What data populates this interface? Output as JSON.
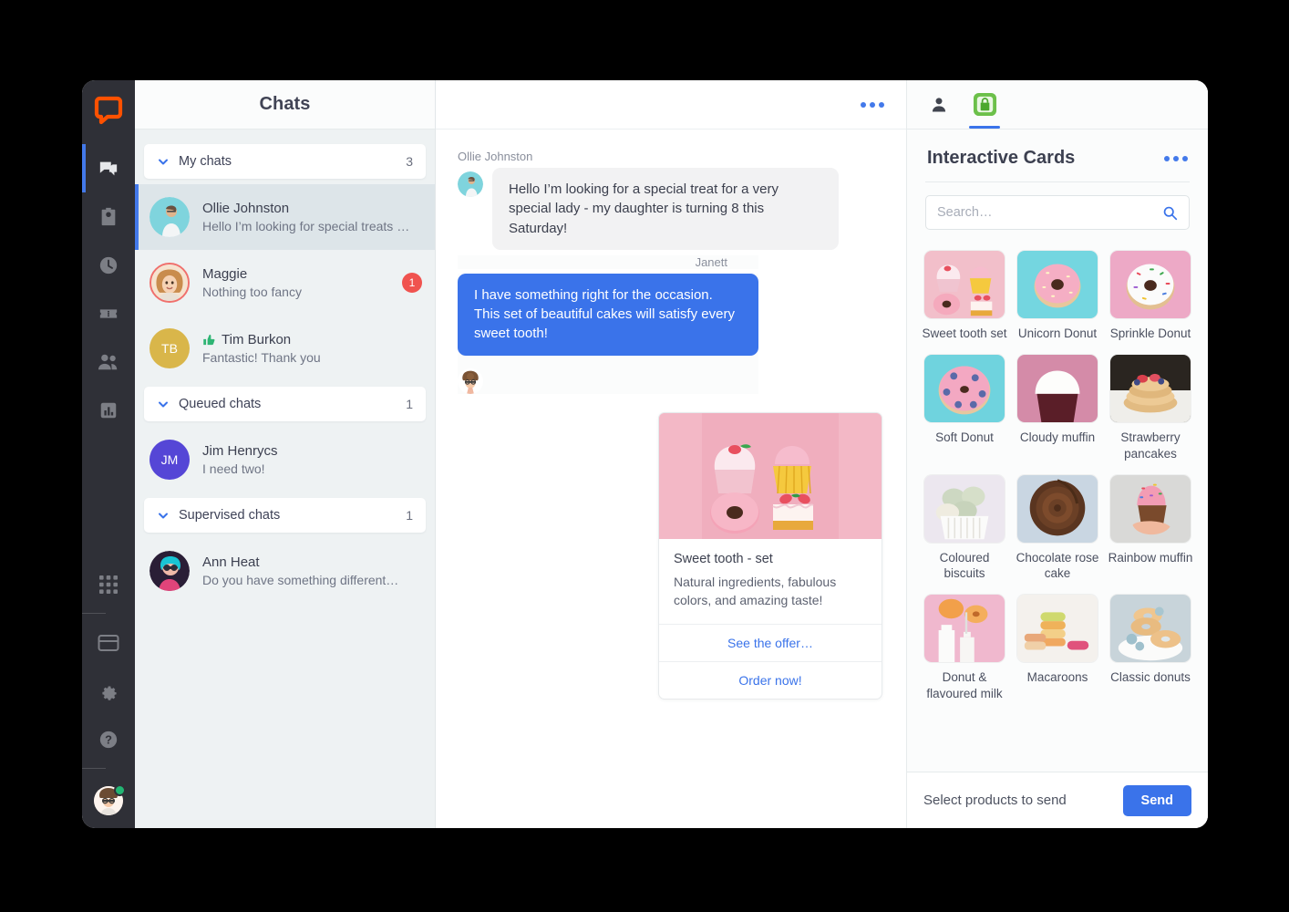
{
  "app": {
    "brand_logo": "livechat-logo",
    "brand_color": "#FF5100"
  },
  "rail": {
    "items": [
      {
        "icon": "chats-icon",
        "name": "chats",
        "active": true
      },
      {
        "icon": "contact-card-icon",
        "name": "engage",
        "active": false
      },
      {
        "icon": "clock-history-icon",
        "name": "archives",
        "active": false
      },
      {
        "icon": "ticket-icon",
        "name": "tickets",
        "active": false
      },
      {
        "icon": "team-icon",
        "name": "team",
        "active": false
      },
      {
        "icon": "reports-chart-icon",
        "name": "reports",
        "active": false
      }
    ],
    "bottom_items": [
      {
        "icon": "apps-grid-icon",
        "name": "apps"
      },
      {
        "icon": "billing-card-icon",
        "name": "billing"
      },
      {
        "icon": "gear-icon",
        "name": "settings"
      },
      {
        "icon": "help-circle-icon",
        "name": "help"
      }
    ],
    "avatar": {
      "name": "agent-avatar",
      "status": "online",
      "status_color": "#22B573"
    }
  },
  "chatlist": {
    "title": "Chats",
    "groups": [
      {
        "label": "My chats",
        "count": "3",
        "rows": [
          {
            "name": "Ollie Johnston",
            "snippet": "Hello I’m looking for special treats …",
            "selected": true,
            "badge": "",
            "initials": "",
            "avatar_type": "photo",
            "ring": false,
            "rating": ""
          },
          {
            "name": "Maggie",
            "snippet": "Nothing too fancy",
            "selected": false,
            "badge": "1",
            "initials": "",
            "avatar_type": "photo",
            "ring": true,
            "rating": ""
          },
          {
            "name": "Tim Burkon",
            "snippet": "Fantastic! Thank you",
            "selected": false,
            "badge": "",
            "initials": "TB",
            "avatar_type": "initials",
            "ring": false,
            "rating": "thumbs-up"
          }
        ]
      },
      {
        "label": "Queued chats",
        "count": "1",
        "rows": [
          {
            "name": "Jim Henrycs",
            "snippet": "I need two!",
            "selected": false,
            "badge": "",
            "initials": "JM",
            "avatar_type": "initials",
            "ring": false,
            "rating": ""
          }
        ]
      },
      {
        "label": "Supervised chats",
        "count": "1",
        "rows": [
          {
            "name": "Ann Heat",
            "snippet": "Do you have something different…",
            "selected": false,
            "badge": "",
            "initials": "",
            "avatar_type": "photo",
            "ring": false,
            "rating": ""
          }
        ]
      }
    ]
  },
  "conversation": {
    "menu_icon": "more-options-icon",
    "messages": [
      {
        "author": "Ollie Johnston",
        "side": "in",
        "text": "Hello I’m looking for a special treat for a very special lady - my daughter is turning 8 this Saturday!"
      },
      {
        "author": "Janett",
        "side": "out",
        "text": "I have something right for the occasion. This set of beautiful cakes will satisfy every sweet tooth!"
      }
    ],
    "rich_card": {
      "image": "sweet-tooth-set-photo",
      "title": "Sweet tooth - set",
      "description": "Natural ingredients, fabulous colors, and amazing taste!",
      "buttons": [
        "See the offer…",
        "Order now!"
      ]
    }
  },
  "right_panel": {
    "tabs": [
      {
        "icon": "person-icon",
        "name": "customer-details",
        "active": false
      },
      {
        "icon": "shopping-bag-icon",
        "name": "interactive-cards",
        "active": true
      }
    ],
    "title": "Interactive Cards",
    "menu_icon": "more-options-icon",
    "search": {
      "placeholder": "Search…",
      "value": "",
      "icon": "search-icon"
    },
    "products": [
      {
        "label": "Sweet tooth set",
        "thumb": "sweet-tooth-set"
      },
      {
        "label": "Unicorn Donut",
        "thumb": "unicorn-donut"
      },
      {
        "label": "Sprinkle Donut",
        "thumb": "sprinkle-donut"
      },
      {
        "label": "Soft Donut",
        "thumb": "soft-donut"
      },
      {
        "label": "Cloudy muffin",
        "thumb": "cloudy-muffin"
      },
      {
        "label": "Strawberry pancakes",
        "thumb": "strawberry-pancakes"
      },
      {
        "label": "Coloured biscuits",
        "thumb": "coloured-biscuits"
      },
      {
        "label": "Chocolate rose cake",
        "thumb": "chocolate-rose-cake"
      },
      {
        "label": "Rainbow muffin",
        "thumb": "rainbow-muffin"
      },
      {
        "label": "Donut & flavoured milk",
        "thumb": "donut-flavoured-milk"
      },
      {
        "label": "Macaroons",
        "thumb": "macaroons"
      },
      {
        "label": "Classic donuts",
        "thumb": "classic-donuts"
      }
    ],
    "footer": {
      "text": "Select products to send",
      "send_label": "Send",
      "send_color": "#3A73EA"
    }
  }
}
